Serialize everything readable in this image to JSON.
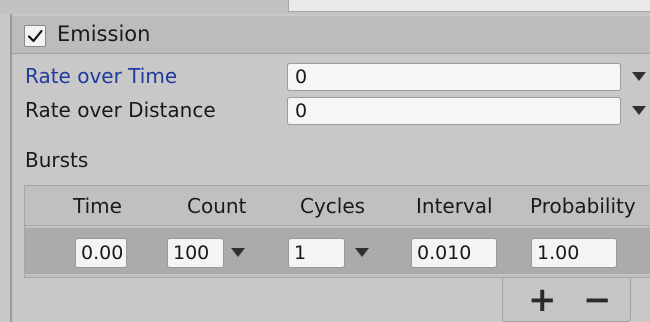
{
  "emission_module": {
    "title": "Emission",
    "enabled": true,
    "rate_over_time": {
      "label": "Rate over Time",
      "value": "0",
      "label_color": "#1f3b9c"
    },
    "rate_over_distance": {
      "label": "Rate over Distance",
      "value": "0"
    }
  },
  "bursts": {
    "title": "Bursts",
    "columns": [
      "Time",
      "Count",
      "Cycles",
      "Interval",
      "Probability"
    ],
    "rows": [
      {
        "time": "0.00",
        "count": "100",
        "cycles": "1",
        "interval": "0.010",
        "probability": "1.00"
      }
    ],
    "add_label": "+",
    "remove_label": "−"
  },
  "icons": {
    "checkmark": "checkmark-icon",
    "dropdown": "triangle-down-icon"
  }
}
